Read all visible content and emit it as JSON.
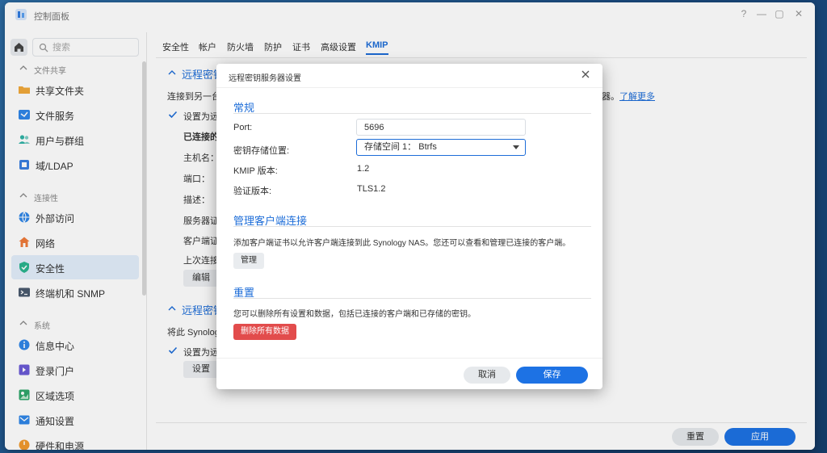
{
  "window": {
    "title": "控制面板"
  },
  "sidebar": {
    "search_placeholder": "搜索",
    "sections": [
      {
        "label": "文件共享",
        "items": [
          {
            "label": "共享文件夹",
            "icon": "folder-icon"
          },
          {
            "label": "文件服务",
            "icon": "file-service-icon"
          },
          {
            "label": "用户与群组",
            "icon": "users-icon"
          },
          {
            "label": "域/LDAP",
            "icon": "domain-icon"
          }
        ]
      },
      {
        "label": "连接性",
        "items": [
          {
            "label": "外部访问",
            "icon": "globe-icon"
          },
          {
            "label": "网络",
            "icon": "network-icon"
          },
          {
            "label": "安全性",
            "icon": "shield-icon",
            "active": true
          },
          {
            "label": "终端机和 SNMP",
            "icon": "terminal-icon"
          }
        ]
      },
      {
        "label": "系统",
        "items": [
          {
            "label": "信息中心",
            "icon": "info-icon"
          },
          {
            "label": "登录门户",
            "icon": "portal-icon"
          },
          {
            "label": "区域选项",
            "icon": "region-icon"
          },
          {
            "label": "通知设置",
            "icon": "notification-icon"
          },
          {
            "label": "硬件和电源",
            "icon": "power-icon"
          }
        ]
      }
    ]
  },
  "tabs": [
    {
      "label": "安全性"
    },
    {
      "label": "帐户"
    },
    {
      "label": "防火墙"
    },
    {
      "label": "防护"
    },
    {
      "label": "证书"
    },
    {
      "label": "高级设置"
    },
    {
      "label": "KMIP",
      "active": true
    }
  ],
  "background": {
    "section1_title": "远程密钥",
    "section1_desc": "连接到另一台 S",
    "section1_desc_tail": "器。",
    "learn_more": "了解更多",
    "checkbox1_label": "设置为远程",
    "connected_header": "已连接的服",
    "fields": [
      "主机名：",
      "端口：",
      "描述：",
      "服务器证书",
      "客户端证书",
      "上次连接："
    ],
    "edit_button": "编辑",
    "section2_title": "远程密钥",
    "section2_desc": "将此 Synology",
    "checkbox2_label": "设置为远程",
    "settings_button": "设置",
    "footer_reset": "重置",
    "footer_apply": "应用"
  },
  "dialog": {
    "title": "远程密钥服务器设置",
    "general": {
      "title": "常规",
      "port_label": "Port:",
      "port_value": "5696",
      "storage_label": "密钥存储位置:",
      "storage_value": "存储空间 1： Btrfs",
      "kmip_label": "KMIP 版本:",
      "kmip_value": "1.2",
      "verify_label": "验证版本:",
      "verify_value": "TLS1.2"
    },
    "manage": {
      "title": "管理客户端连接",
      "desc": "添加客户端证书以允许客户端连接到此 Synology NAS。您还可以查看和管理已连接的客户端。",
      "button": "管理"
    },
    "reset": {
      "title": "重置",
      "desc": "您可以删除所有设置和数据，包括已连接的客户端和已存储的密钥。",
      "button": "删除所有数据"
    },
    "cancel": "取消",
    "save": "保存"
  },
  "colors": {
    "accent": "#1d72e4",
    "danger": "#e24c4c",
    "link": "#1d6dd8"
  }
}
